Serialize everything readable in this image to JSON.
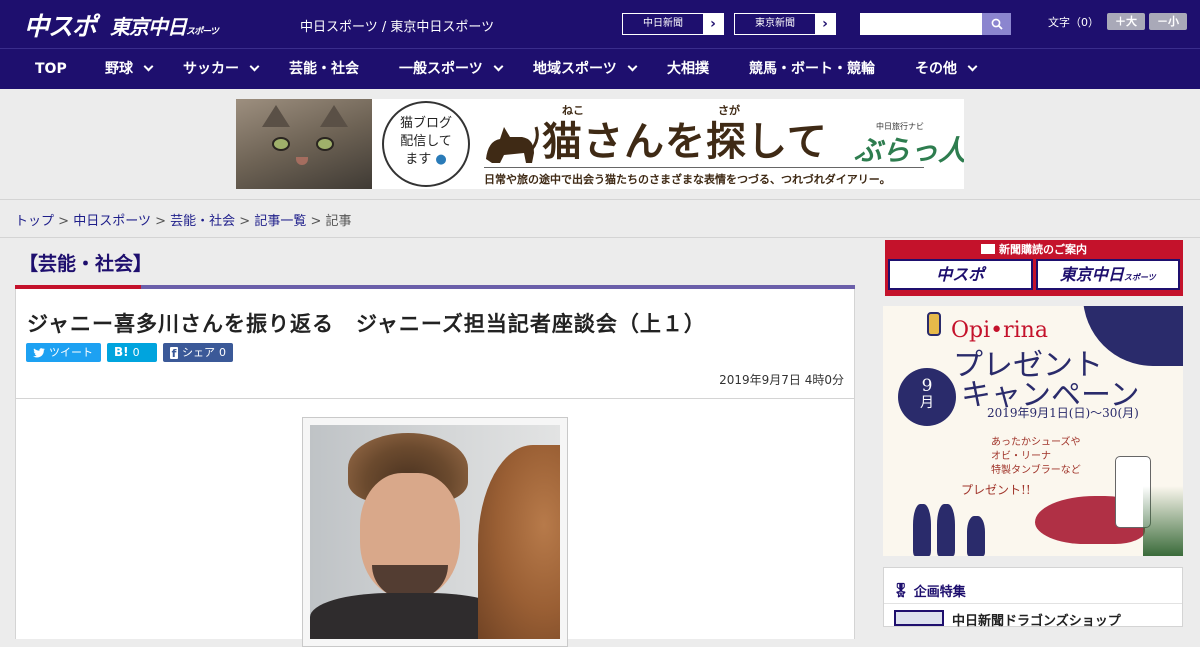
{
  "header": {
    "logo_chuspo": "中スポ",
    "logo_tokyo": "東京中日",
    "logo_tokyo_small": "スポーツ",
    "site_names": "中日スポーツ / 東京中日スポーツ",
    "paper_links": [
      {
        "label": "中日新聞",
        "arrow": "›"
      },
      {
        "label": "東京新聞",
        "arrow": "›"
      }
    ],
    "search_placeholder": "",
    "fontsize_label": "文字（0）",
    "fontsize_up": "＋大",
    "fontsize_down": "－小"
  },
  "nav": {
    "items": [
      {
        "label": "TOP",
        "dropdown": false
      },
      {
        "label": "野球",
        "dropdown": true
      },
      {
        "label": "サッカー",
        "dropdown": true
      },
      {
        "label": "芸能・社会",
        "dropdown": false
      },
      {
        "label": "一般スポーツ",
        "dropdown": true
      },
      {
        "label": "地域スポーツ",
        "dropdown": true
      },
      {
        "label": "大相撲",
        "dropdown": false
      },
      {
        "label": "競馬・ボート・競輪",
        "dropdown": false
      },
      {
        "label": "その他",
        "dropdown": true
      }
    ]
  },
  "banner": {
    "bubble_l1": "猫ブログ",
    "bubble_l2": "配信して",
    "bubble_l3": "ます",
    "title_main": "猫さんを探して",
    "kana_neko": "ねこ",
    "kana_saga": "さが",
    "subtitle": "日常や旅の途中で出会う猫たちのさまざまな表情をつづる、つれづれダイアリー。",
    "navi_small": "中日旅行ナビ",
    "brand": "ぶらっ人"
  },
  "breadcrumb": {
    "items": [
      "トップ",
      "中日スポーツ",
      "芸能・社会",
      "記事一覧"
    ],
    "separator": ">",
    "current": "記事"
  },
  "article": {
    "category": "【芸能・社会】",
    "title": "ジャニー喜多川さんを振り返る　ジャニーズ担当記者座談会（上１）",
    "share_tweet": "ツイート",
    "share_hatena_icon": "B!",
    "share_hatena_count": "0",
    "share_fb_label": "シェア",
    "share_fb_count": "0",
    "date": "2019年9月7日 4時0分"
  },
  "sidebar": {
    "subscribe_title": "新聞購読のご案内",
    "subscribe_chuspo": "中スポ",
    "subscribe_tokyo": "東京中日",
    "subscribe_tokyo_small": "スポーツ",
    "promo_brand": "Opi•rina",
    "promo_title_1": "プレゼント",
    "promo_title_2": "キャンペーン",
    "promo_month_num": "9",
    "promo_month_unit": "月",
    "promo_dates": "2019年9月1日(日)〜30(月)",
    "promo_desc_1": "あったかシューズや",
    "promo_desc_2": "オビ・リーナ",
    "promo_desc_3": "特製タンブラーなど",
    "promo_present": "プレゼント!!",
    "feature_title": "企画特集",
    "feature_item": "中日新聞ドラゴンズショップ"
  },
  "colors": {
    "header_bg": "#1e0f6e",
    "accent_red": "#c4122b",
    "accent_purple": "#6b5faa"
  }
}
